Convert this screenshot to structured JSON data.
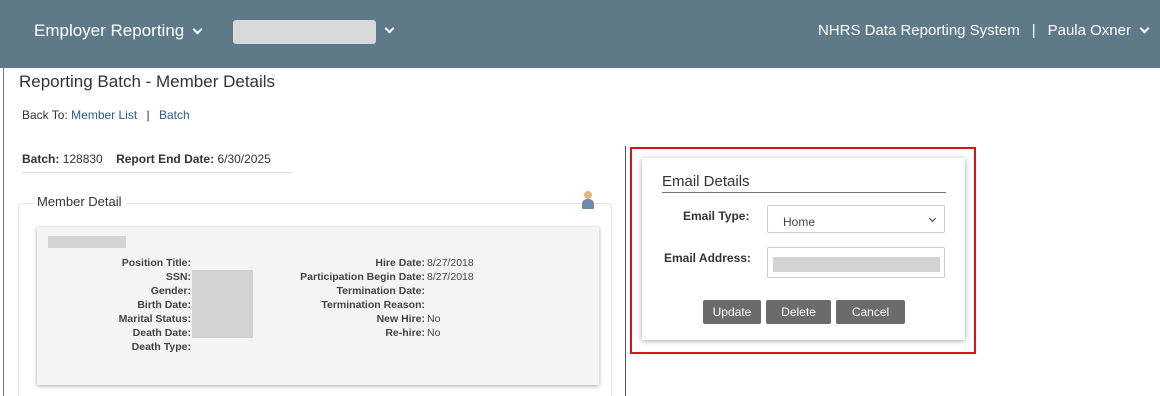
{
  "header": {
    "app_menu_label": "Employer Reporting",
    "system_name": "NHRS Data Reporting System",
    "separator": "|",
    "user_name": "Paula Oxner"
  },
  "page": {
    "title": "Reporting Batch - Member Details",
    "back_to_label": "Back To:",
    "back_links": [
      "Member List",
      "Batch"
    ],
    "back_separator": "|",
    "batch_label": "Batch:",
    "batch_value": "128830",
    "report_end_label": "Report End Date:",
    "report_end_value": "6/30/2025"
  },
  "member_detail": {
    "legend": "Member Detail",
    "left_fields": [
      {
        "label": "Position Title:",
        "value": ""
      },
      {
        "label": "SSN:",
        "value": ""
      },
      {
        "label": "Gender:",
        "value": ""
      },
      {
        "label": "Birth Date:",
        "value": ""
      },
      {
        "label": "Marital Status:",
        "value": ""
      },
      {
        "label": "Death Date:",
        "value": ""
      },
      {
        "label": "Death Type:",
        "value": ""
      }
    ],
    "right_fields": [
      {
        "label": "Hire Date:",
        "value": "8/27/2018"
      },
      {
        "label": "Participation Begin Date:",
        "value": "8/27/2018"
      },
      {
        "label": "Termination Date:",
        "value": ""
      },
      {
        "label": "Termination Reason:",
        "value": ""
      },
      {
        "label": "New Hire:",
        "value": "No"
      },
      {
        "label": "Re-hire:",
        "value": "No"
      }
    ]
  },
  "email_dialog": {
    "title": "Email Details",
    "email_type_label": "Email Type:",
    "email_type_value": "Home",
    "email_address_label": "Email Address:",
    "buttons": {
      "update": "Update",
      "delete": "Delete",
      "cancel": "Cancel"
    }
  },
  "colors": {
    "header_bg": "#5e7a89",
    "link": "#2a5a8a",
    "highlight": "#d41616",
    "button_bg": "#6b6b6b"
  },
  "icons": [
    "chevron-down-icon",
    "member-person-icon",
    "dropdown-caret-icon"
  ]
}
